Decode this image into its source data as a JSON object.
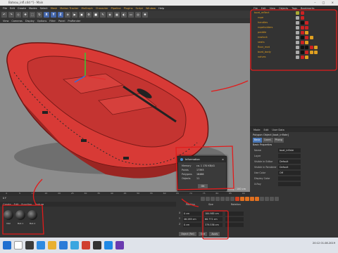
{
  "window": {
    "title": "Bateau_infl.c4d *] - Main",
    "controls": "–  □  ×"
  },
  "menubar": [
    "File",
    "Edit",
    "Create",
    "Modes",
    "Select",
    "Mesh",
    "Motion Tracker",
    "MoGraph",
    "Character",
    "Pipeline",
    "Plugins",
    "Script",
    "Window",
    "Help"
  ],
  "toolbar": {
    "xyz": [
      "X",
      "Y",
      "Z"
    ]
  },
  "view_menu": [
    "View",
    "Cameras",
    "Display",
    "Options",
    "Filter",
    "Panel",
    "ProRender"
  ],
  "viewport": {
    "grid_spacing": "Grid Spacing : 100 cm"
  },
  "object_manager": {
    "menu": [
      "File",
      "Edit",
      "View",
      "Objects",
      "Tags",
      "Bookmarks"
    ],
    "objects": [
      {
        "name": "boat_reflect",
        "indent": 0,
        "tags": [
          "#aa3",
          "#c22"
        ]
      },
      {
        "name": "rope",
        "indent": 1,
        "tags": [
          "#aaa",
          "#c22"
        ]
      },
      {
        "name": "handles",
        "indent": 1,
        "tags": [
          "#aaa",
          "#111",
          "#c22"
        ]
      },
      {
        "name": "ropeholders",
        "indent": 1,
        "tags": [
          "#aaa",
          "#c22",
          "#c22"
        ]
      },
      {
        "name": "paddle",
        "indent": 1,
        "tags": [
          "#aaa",
          "#c22",
          "#e0a020"
        ]
      },
      {
        "name": "rowlock",
        "indent": 1,
        "tags": [
          "#aaa",
          "#111",
          "#c22",
          "#e0a020"
        ]
      },
      {
        "name": "seats",
        "indent": 1,
        "tags": [
          "#aaa",
          "#c22",
          "#e0a020"
        ]
      },
      {
        "name": "floor_mat",
        "indent": 1,
        "tags": [
          "#aaa",
          "#111",
          "#111",
          "#c22",
          "#e0a020"
        ]
      },
      {
        "name": "boat_body",
        "indent": 1,
        "tags": [
          "#aaa",
          "#111",
          "#c22",
          "#e0a020",
          "#e0a020"
        ]
      },
      {
        "name": "valves",
        "indent": 1,
        "tags": [
          "#aaa",
          "#c22",
          "#e0a020"
        ]
      }
    ]
  },
  "attribute_manager": {
    "menu": [
      "Mode",
      "Edit",
      "User Data"
    ],
    "title": "Polygon Object [boat_inflate]",
    "tabs": [
      "Basic",
      "Coord.",
      "Phong"
    ],
    "section": "Basic Properties",
    "rows": [
      {
        "label": "Name",
        "value": "boat_inflate"
      },
      {
        "label": "Layer",
        "value": ""
      },
      {
        "label": "Visible in Editor",
        "value": "Default"
      },
      {
        "label": "Visible in Renderer",
        "value": "Default"
      },
      {
        "label": "Use Color",
        "value": "Off"
      },
      {
        "label": "Display Color",
        "value": ""
      },
      {
        "label": "X-Ray",
        "value": ""
      }
    ]
  },
  "timeline": {
    "ticks": [
      "0",
      "5",
      "10",
      "15",
      "20",
      "25",
      "30",
      "35",
      "40",
      "45",
      "50",
      "55",
      "60",
      "65",
      "70",
      "75",
      "80",
      "85",
      "90"
    ],
    "current": "0 F"
  },
  "material_manager": {
    "menu": [
      "Create",
      "Edit",
      "Function",
      "Texture"
    ],
    "materials": [
      "Mat",
      "Mat.1",
      "Mat.2"
    ]
  },
  "coordinates": {
    "headers": [
      "Position",
      "Size",
      "Rotation"
    ],
    "rows": [
      {
        "axis": "X",
        "pos": "0 cm",
        "size": "184.985 cm"
      },
      {
        "axis": "Y",
        "pos": "46.289 cm",
        "size": "60.771 cm"
      },
      {
        "axis": "Z",
        "pos": "0 cm",
        "size": "379.536 cm"
      }
    ],
    "mode_button": "Object (Rel)",
    "size_button": "Size",
    "apply_button": "Apply"
  },
  "info_dialog": {
    "title": "Information",
    "rows": [
      {
        "k": "Memory",
        "v": "ca. 1 170 KB/41"
      },
      {
        "k": "Points",
        "v": "17393"
      },
      {
        "k": "Polygons",
        "v": "16466"
      },
      {
        "k": "Objects",
        "v": "11"
      }
    ],
    "ok_label": "OK"
  },
  "taskbar": {
    "clock": "20:12",
    "date": "01.08.2019"
  },
  "colors": {
    "accent": "#e21b1b",
    "boat": "#d83a36",
    "viewport": "#8c8c8c",
    "panel": "#333333"
  }
}
